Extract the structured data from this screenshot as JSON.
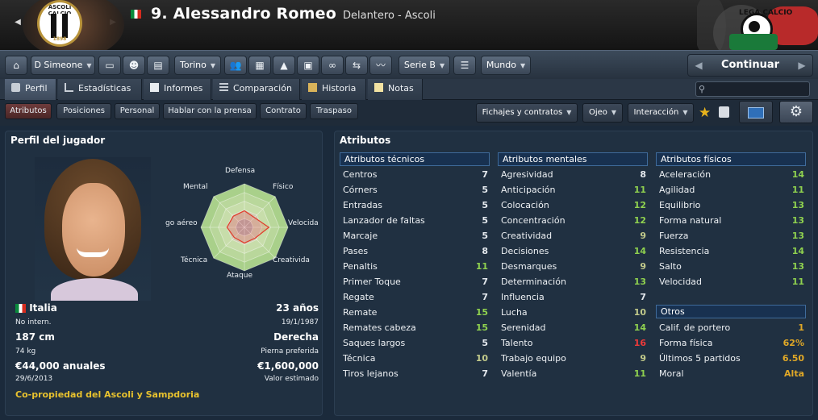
{
  "header": {
    "shirt_number_name": "9. Alessandro Romeo",
    "position_club": "Delantero - Ascoli",
    "club_badge_text": "ASCOLI CALCIO",
    "club_badge_year": "1898",
    "league_logo_text": "LEGA CALCIO"
  },
  "toolbar": {
    "manager": "D Simeone",
    "club": "Torino",
    "league": "Serie B",
    "world": "Mundo",
    "continue": "Continuar"
  },
  "tabs": [
    "Perfil",
    "Estadísticas",
    "Informes",
    "Comparación",
    "Historia",
    "Notas"
  ],
  "search": {
    "placeholder": ""
  },
  "subtabs": [
    "Atributos",
    "Posiciones",
    "Personal",
    "Hablar con la prensa",
    "Contrato",
    "Traspaso"
  ],
  "menus": [
    "Fichajes y contratos",
    "Ojeo",
    "Interacción"
  ],
  "profile": {
    "title": "Perfil del jugador",
    "radar": {
      "axes": [
        "Defensa",
        "Físico",
        "Velocidad",
        "Creatividad",
        "Ataque",
        "Técnica",
        "Juego aéreo",
        "Mental"
      ],
      "values": [
        0.38,
        0.32,
        0.56,
        0.35,
        0.36,
        0.33,
        0.4,
        0.36
      ],
      "visible_labels": [
        "Defensa",
        "Físico",
        "Velocida",
        "Creativida",
        "Ataque",
        "Técnica",
        "go aéreo",
        "Mental"
      ]
    },
    "nationality": "Italia",
    "age": "23 años",
    "intl": "No intern.",
    "dob": "19/1/1987",
    "height": "187 cm",
    "foot": "Derecha",
    "weight": "74 kg",
    "foot_label": "Pierna preferida",
    "wage": "€44,000 anuales",
    "value": "€1,600,000",
    "contract_end": "29/6/2013",
    "value_label": "Valor estimado",
    "coownership": "Co-propiedad del Ascoli y Sampdoria"
  },
  "attributes": {
    "title": "Atributos",
    "technical_title": "Atributos técnicos",
    "technical": [
      {
        "n": "Centros",
        "v": "7"
      },
      {
        "n": "Córners",
        "v": "5"
      },
      {
        "n": "Entradas",
        "v": "5"
      },
      {
        "n": "Lanzador de faltas",
        "v": "5"
      },
      {
        "n": "Marcaje",
        "v": "5"
      },
      {
        "n": "Pases",
        "v": "8"
      },
      {
        "n": "Penaltis",
        "v": "11"
      },
      {
        "n": "Primer Toque",
        "v": "7"
      },
      {
        "n": "Regate",
        "v": "7"
      },
      {
        "n": "Remate",
        "v": "15"
      },
      {
        "n": "Remates cabeza",
        "v": "15"
      },
      {
        "n": "Saques largos",
        "v": "5"
      },
      {
        "n": "Técnica",
        "v": "10"
      },
      {
        "n": "Tiros lejanos",
        "v": "7"
      }
    ],
    "mental_title": "Atributos mentales",
    "mental": [
      {
        "n": "Agresividad",
        "v": "8"
      },
      {
        "n": "Anticipación",
        "v": "11"
      },
      {
        "n": "Colocación",
        "v": "12"
      },
      {
        "n": "Concentración",
        "v": "12"
      },
      {
        "n": "Creatividad",
        "v": "9"
      },
      {
        "n": "Decisiones",
        "v": "14"
      },
      {
        "n": "Desmarques",
        "v": "9"
      },
      {
        "n": "Determinación",
        "v": "13"
      },
      {
        "n": "Influencia",
        "v": "7"
      },
      {
        "n": "Lucha",
        "v": "10"
      },
      {
        "n": "Serenidad",
        "v": "14"
      },
      {
        "n": "Talento",
        "v": "16"
      },
      {
        "n": "Trabajo equipo",
        "v": "9"
      },
      {
        "n": "Valentía",
        "v": "11"
      }
    ],
    "physical_title": "Atributos físicos",
    "physical": [
      {
        "n": "Aceleración",
        "v": "14"
      },
      {
        "n": "Agilidad",
        "v": "11"
      },
      {
        "n": "Equilibrio",
        "v": "13"
      },
      {
        "n": "Forma natural",
        "v": "13"
      },
      {
        "n": "Fuerza",
        "v": "13"
      },
      {
        "n": "Resistencia",
        "v": "14"
      },
      {
        "n": "Salto",
        "v": "13"
      },
      {
        "n": "Velocidad",
        "v": "11"
      }
    ],
    "other_title": "Otros",
    "other": [
      {
        "n": "Calif. de portero",
        "v": "1",
        "c": "#e0a827"
      },
      {
        "n": "Forma física",
        "v": "62%",
        "c": "#e0a827"
      },
      {
        "n": "Últimos 5 partidos",
        "v": "6.50",
        "c": "#e0a827"
      },
      {
        "n": "Moral",
        "v": "Alta",
        "c": "#e0a827"
      }
    ]
  },
  "colors": {
    "low": "#e4e9ee",
    "mid": "#c2ca8b",
    "high": "#8fd14f",
    "top": "#ee3a3a",
    "header_bg": "#183150"
  }
}
